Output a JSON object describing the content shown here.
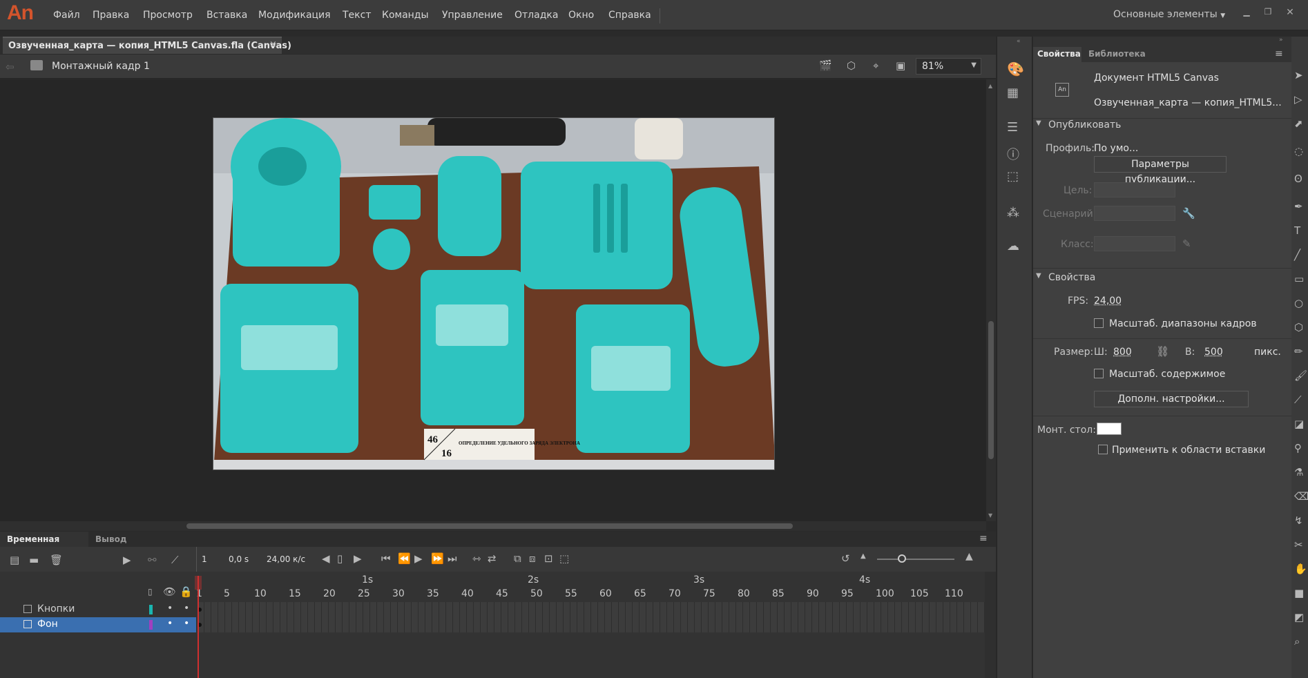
{
  "app": {
    "logo": "An"
  },
  "menu": [
    "Файл",
    "Правка",
    "Просмотр",
    "Вставка",
    "Модификация",
    "Текст",
    "Команды",
    "Управление",
    "Отладка",
    "Окно",
    "Справка"
  ],
  "workspace": "Основные элементы",
  "document_tab": {
    "title": "Озвученная_карта — копия_HTML5 Canvas.fla (Canvas)",
    "close": "×"
  },
  "scene": {
    "name": "Монтажный кадр 1",
    "zoom": "81%"
  },
  "canvas_image": {
    "sign_number_top": "46",
    "sign_number_bottom": "16",
    "sign_text": "ОПРЕДЕЛЕНИЕ УДЕЛЬНОГО ЗАРЯДА ЭЛЕКТРОНА",
    "teal": "#2ec4c0",
    "board": "#6b3a24"
  },
  "properties": {
    "tabs": [
      "Свойства",
      "Библиотека"
    ],
    "doc_type": "Документ HTML5 Canvas",
    "doc_name": "Озвученная_карта — копия_HTML5...",
    "publish": {
      "header": "Опубликовать",
      "profile_label": "Профиль:",
      "profile_value": "По умо...",
      "settings_button": "Параметры публикации...",
      "target_label": "Цель:",
      "script_label": "Сценарий:",
      "class_label": "Класс:"
    },
    "props": {
      "header": "Свойства",
      "fps_label": "FPS:",
      "fps_value": "24,00",
      "scale_spans": "Масштаб. диапазоны кадров",
      "size_label": "Размер:",
      "w_label": "Ш:",
      "w_value": "800",
      "h_label": "В:",
      "h_value": "500",
      "unit": "пикс.",
      "scale_content": "Масштаб. содержимое",
      "advanced_button": "Дополн. настройки...",
      "stage_label": "Монт. стол:",
      "stage_color": "#ffffff",
      "apply_paste": "Применить к области вставки"
    }
  },
  "timeline": {
    "tabs": [
      "Временная шкала",
      "Вывод"
    ],
    "frame": "1",
    "time": "0,0 s",
    "fps": "24,00 к/с",
    "seconds": [
      "1s",
      "2s",
      "3s",
      "4s"
    ],
    "ticks": [
      "1",
      "5",
      "10",
      "15",
      "20",
      "25",
      "30",
      "35",
      "40",
      "45",
      "50",
      "55",
      "60",
      "65",
      "70",
      "75",
      "80",
      "85",
      "90",
      "95",
      "100",
      "105",
      "110"
    ],
    "layers": [
      {
        "name": "Кнопки",
        "color": "#1ab5b0"
      },
      {
        "name": "Фон",
        "color": "#a040c0"
      }
    ]
  }
}
